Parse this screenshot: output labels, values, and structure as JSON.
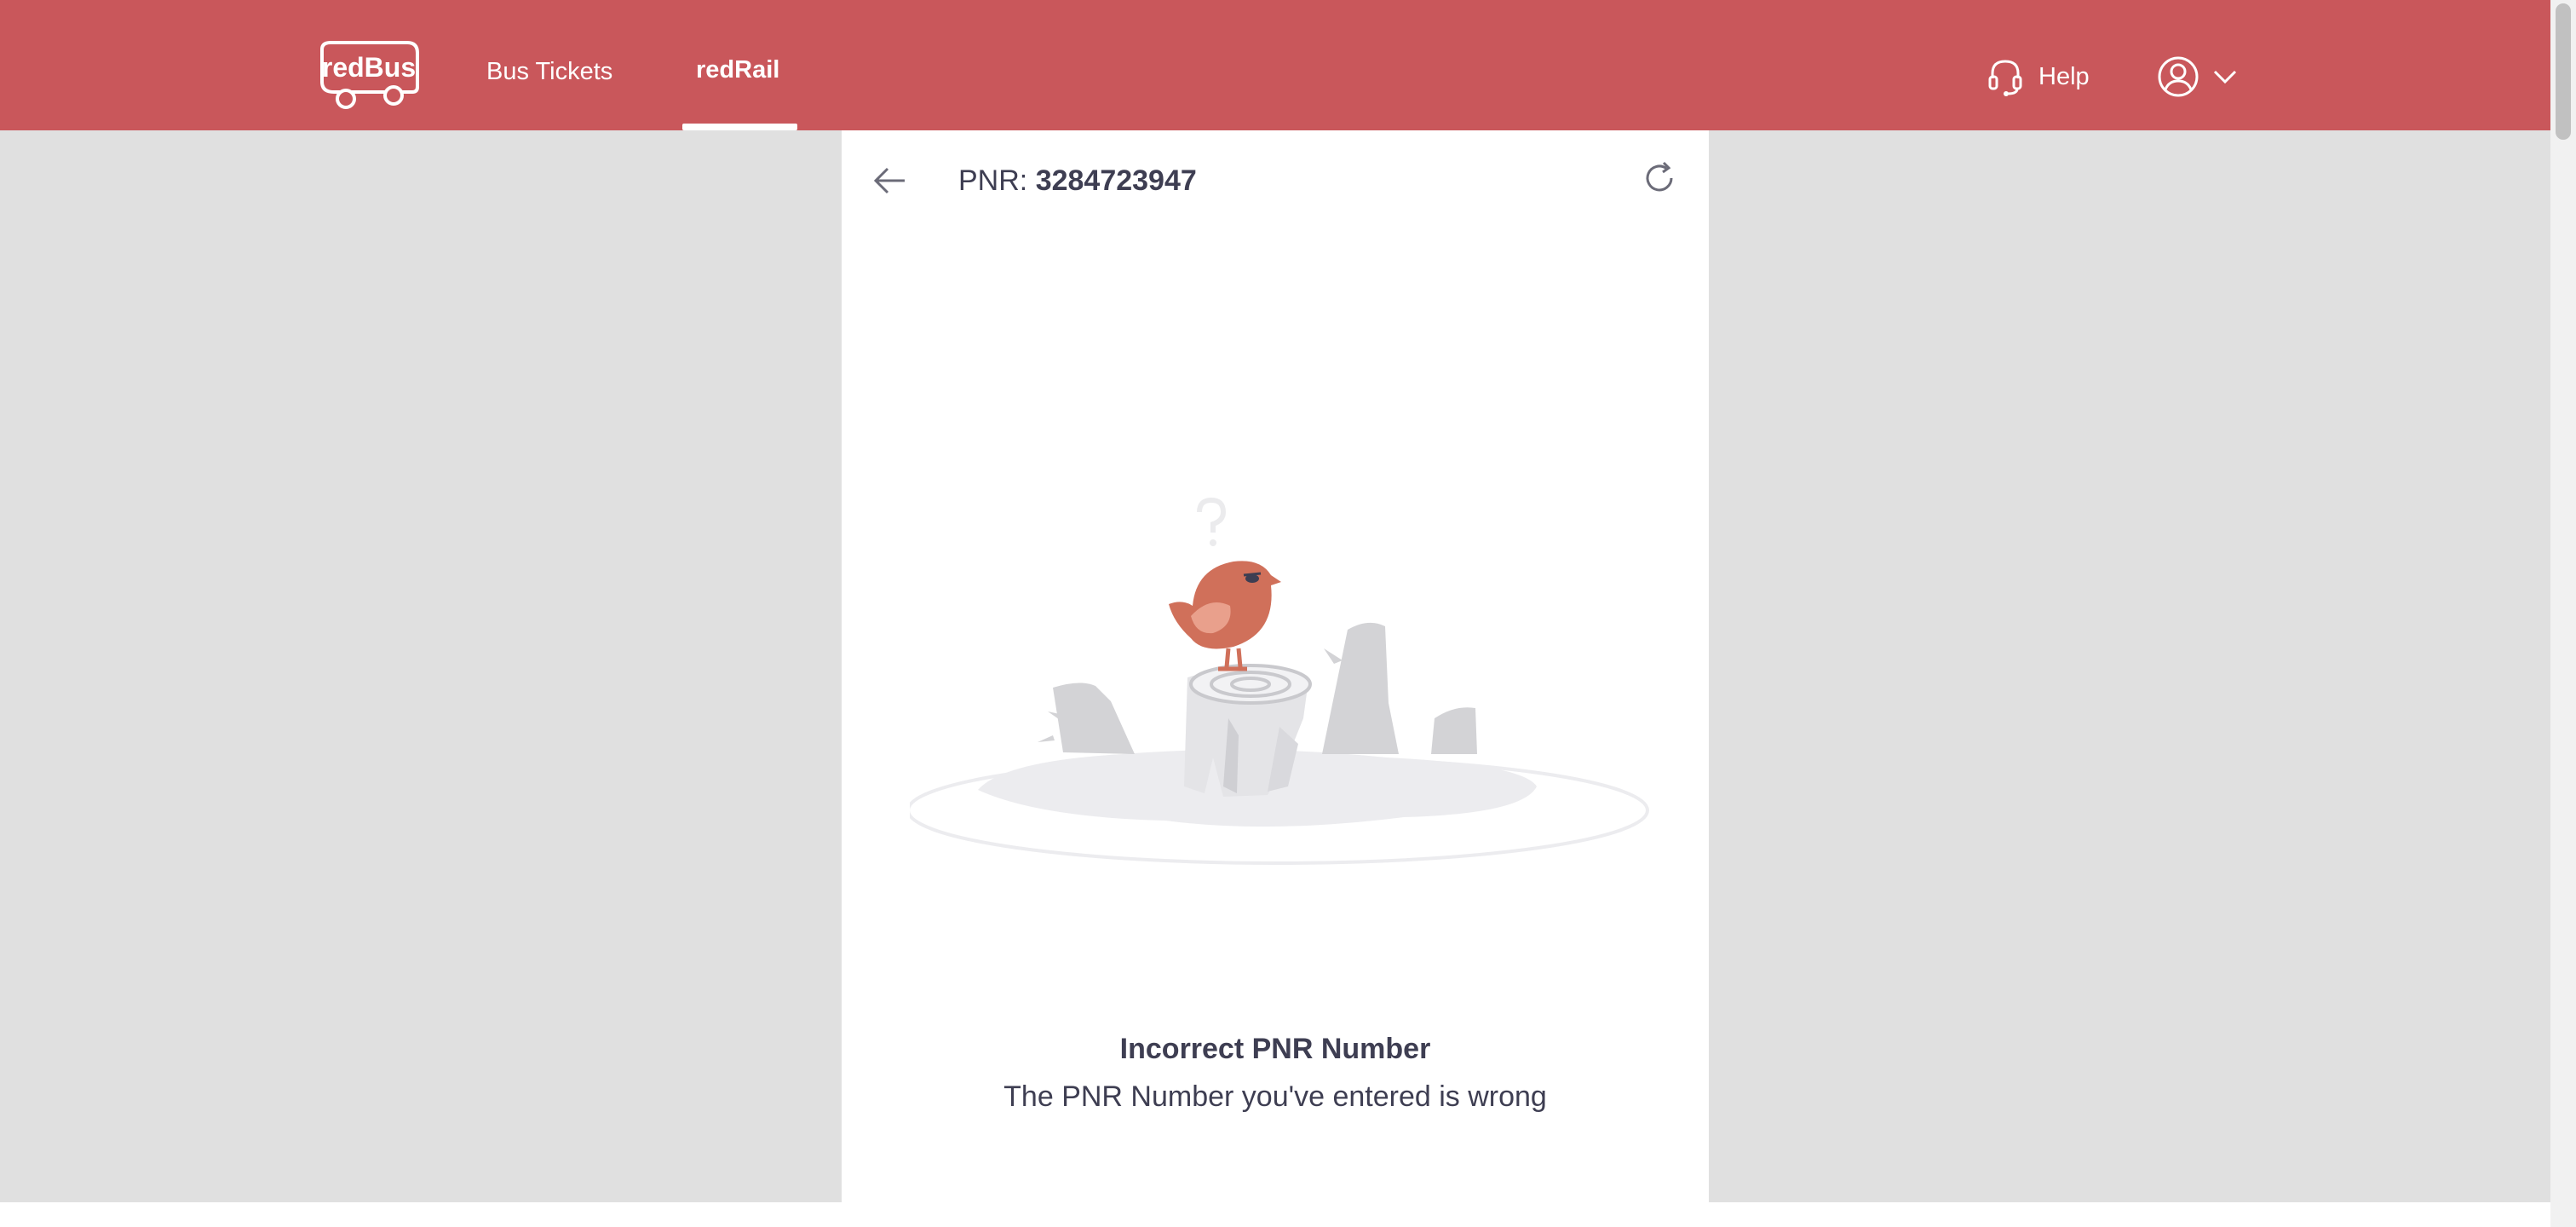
{
  "brand": {
    "logo_text": "redBus",
    "primary_color": "#c9575b"
  },
  "nav": {
    "bus_tickets": "Bus Tickets",
    "red_rail": "redRail",
    "active": "redRail"
  },
  "header_right": {
    "help_label": "Help",
    "help_icon": "headset-icon",
    "account_icon": "user-circle-icon",
    "dropdown_icon": "chevron-down-icon"
  },
  "pnr_panel": {
    "back_icon": "arrow-left-icon",
    "pnr_prefix": "PNR:",
    "pnr_number": "3284723947",
    "refresh_icon": "refresh-icon",
    "illustration": "bird-on-tree-stump",
    "error_title": "Incorrect PNR Number",
    "error_message": "The PNR Number you've entered is wrong"
  }
}
